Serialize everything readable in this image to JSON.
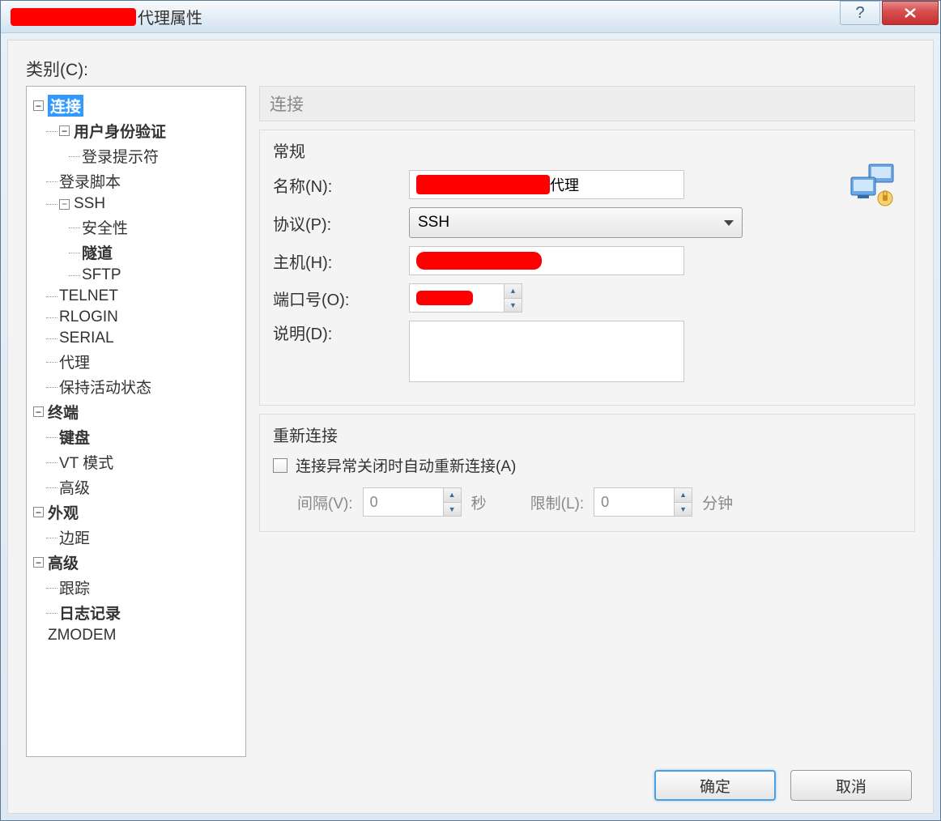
{
  "window": {
    "title_suffix": "代理属性"
  },
  "category_label": "类别(C):",
  "tree": {
    "connection": "连接",
    "user_auth": "用户身份验证",
    "login_prompt": "登录提示符",
    "login_script": "登录脚本",
    "ssh": "SSH",
    "security": "安全性",
    "tunnel": "隧道",
    "sftp": "SFTP",
    "telnet": "TELNET",
    "rlogin": "RLOGIN",
    "serial": "SERIAL",
    "proxy": "代理",
    "keepalive": "保持活动状态",
    "terminal": "终端",
    "keyboard": "键盘",
    "vt_mode": "VT 模式",
    "advanced_term": "高级",
    "appearance": "外观",
    "margin": "边距",
    "advanced": "高级",
    "trace": "跟踪",
    "logging": "日志记录",
    "zmodem": "ZMODEM"
  },
  "panel": {
    "heading": "连接",
    "general": {
      "title": "常规",
      "name_label": "名称(N):",
      "name_value_suffix": "代理",
      "protocol_label": "协议(P):",
      "protocol_value": "SSH",
      "host_label": "主机(H):",
      "port_label": "端口号(O):",
      "desc_label": "说明(D):"
    },
    "reconnect": {
      "title": "重新连接",
      "checkbox_label": "连接异常关闭时自动重新连接(A)",
      "interval_label": "间隔(V):",
      "interval_value": "0",
      "interval_unit": "秒",
      "limit_label": "限制(L):",
      "limit_value": "0",
      "limit_unit": "分钟"
    }
  },
  "buttons": {
    "ok": "确定",
    "cancel": "取消"
  }
}
